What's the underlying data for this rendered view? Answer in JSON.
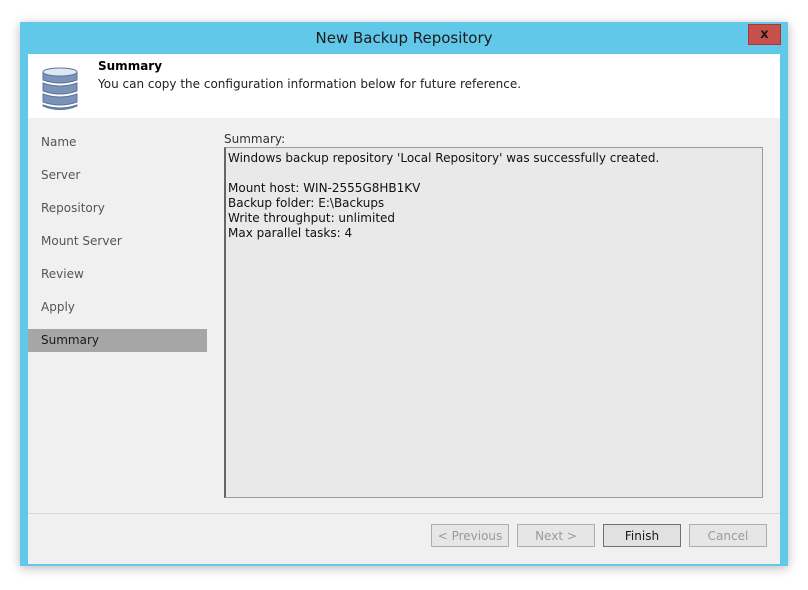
{
  "window": {
    "title": "New Backup Repository",
    "close_label": "x"
  },
  "header": {
    "title": "Summary",
    "description": "You can copy the configuration information below for future reference."
  },
  "nav": {
    "items": [
      {
        "label": "Name"
      },
      {
        "label": "Server"
      },
      {
        "label": "Repository"
      },
      {
        "label": "Mount Server"
      },
      {
        "label": "Review"
      },
      {
        "label": "Apply"
      },
      {
        "label": "Summary",
        "active": true
      }
    ]
  },
  "summary": {
    "label": "Summary:",
    "text": "Windows backup repository 'Local Repository' was successfully created.\n\nMount host: WIN-2555G8HB1KV\nBackup folder: E:\\Backups\nWrite throughput: unlimited\nMax parallel tasks: 4"
  },
  "buttons": {
    "previous": "< Previous",
    "next": "Next >",
    "finish": "Finish",
    "cancel": "Cancel"
  },
  "colors": {
    "titlebar": "#62c8ea",
    "close_button": "#c7504c",
    "nav_active": "#a6a6a6"
  },
  "icons": {
    "header": "database-icon"
  }
}
